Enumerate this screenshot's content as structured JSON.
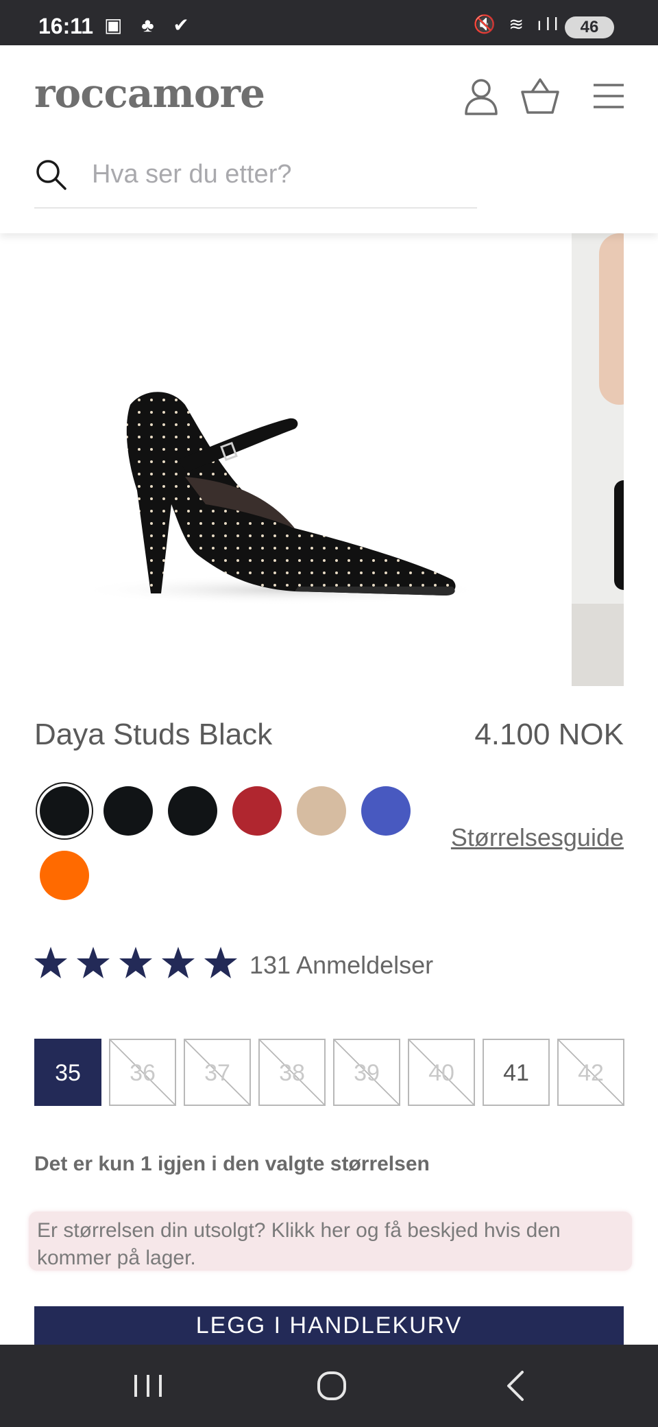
{
  "status_bar": {
    "time": "16:11",
    "left_icons": "▣ ♣ ✔",
    "right_icons": "🔇 ≋ ıll",
    "battery": "46"
  },
  "header": {
    "logo": "roccamore",
    "search_placeholder": "Hva ser du etter?"
  },
  "product": {
    "name": "Daya Studs Black",
    "price": "4.100 NOK",
    "colors": [
      {
        "hex": "#111416",
        "selected": true
      },
      {
        "hex": "#111416",
        "selected": false
      },
      {
        "hex": "#111416",
        "selected": false
      },
      {
        "hex": "#b0262f",
        "selected": false
      },
      {
        "hex": "#d6bca1",
        "selected": false
      },
      {
        "hex": "#4859c0",
        "selected": false
      },
      {
        "hex": "#ff6a00",
        "selected": false
      }
    ],
    "size_guide_label": "Størrelsesguide",
    "rating": 5,
    "reviews_label": "131 Anmeldelser",
    "sizes": [
      {
        "label": "35",
        "state": "selected"
      },
      {
        "label": "36",
        "state": "sold-out"
      },
      {
        "label": "37",
        "state": "sold-out"
      },
      {
        "label": "38",
        "state": "sold-out"
      },
      {
        "label": "39",
        "state": "sold-out"
      },
      {
        "label": "40",
        "state": "sold-out"
      },
      {
        "label": "41",
        "state": "available"
      },
      {
        "label": "42",
        "state": "sold-out"
      }
    ],
    "stock_message": "Det er kun 1 igjen i den valgte størrelsen",
    "notify_message": "Er størrelsen din utsolgt? Klikk her og få beskjed hvis den kommer på lager.",
    "add_to_cart_label": "LEGG I HANDLEKURV"
  },
  "colors": {
    "brand_navy": "#232a57",
    "star": "#232a57",
    "notify_bg": "#f6e7e9"
  }
}
